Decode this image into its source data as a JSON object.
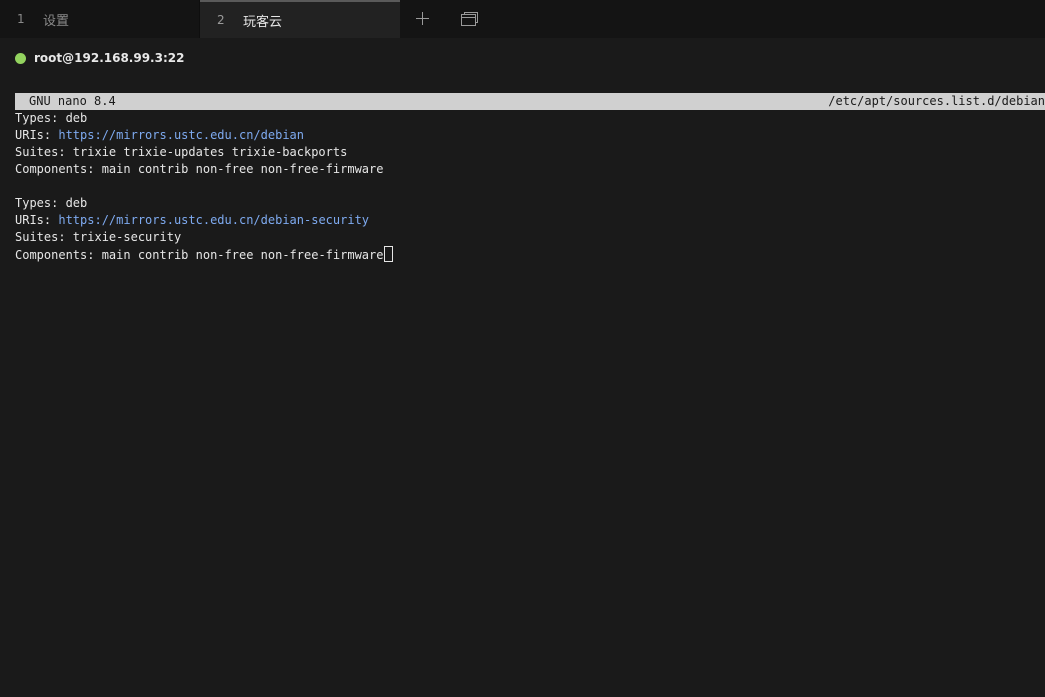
{
  "tabs": [
    {
      "num": "1",
      "label": "设置"
    },
    {
      "num": "2",
      "label": "玩客云"
    }
  ],
  "connection": {
    "label": "root@192.168.99.3:22",
    "status_color": "#93d35f"
  },
  "nano": {
    "version": "GNU nano 8.4",
    "file_path": "/etc/apt/sources.list.d/debian"
  },
  "file_lines": [
    {
      "key": "Types: ",
      "value": "deb"
    },
    {
      "key": "URIs: ",
      "value": "https://mirrors.ustc.edu.cn/debian"
    },
    {
      "key": "Suites: ",
      "value": "trixie trixie-updates trixie-backports"
    },
    {
      "key": "Components: ",
      "value": "main contrib non-free non-free-firmware"
    },
    {
      "key": "",
      "value": ""
    },
    {
      "key": "Types: ",
      "value": "deb"
    },
    {
      "key": "URIs: ",
      "value": "https://mirrors.ustc.edu.cn/debian-security"
    },
    {
      "key": "Suites: ",
      "value": "trixie-security"
    },
    {
      "key": "Components: ",
      "value": "main contrib non-free non-free-firmware"
    }
  ],
  "colors": {
    "background": "#1a1a1a",
    "url": "#7eaaf0",
    "nano_header_bg": "#d0d0d0",
    "status_dot": "#93d35f"
  },
  "icons": {
    "new_tab": "plus-icon",
    "windows": "windows-icon"
  }
}
